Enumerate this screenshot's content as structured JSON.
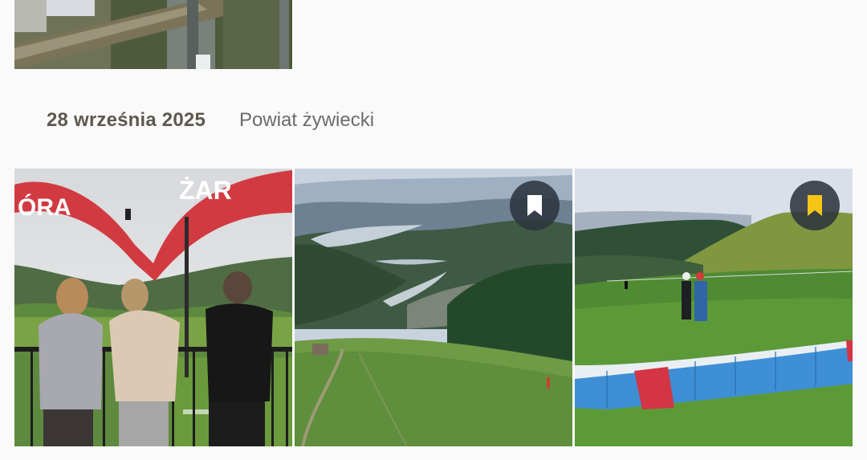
{
  "section": {
    "date": "28 września 2025",
    "location": "Powiat żywiecki"
  },
  "photos": [
    {
      "sign_left": "ÓRA",
      "sign_right": "ŻAR",
      "bookmark": null
    },
    {
      "bookmark": {
        "state": "unselected",
        "icon": "bookmark-icon",
        "color": "#ffffff"
      }
    },
    {
      "bookmark": {
        "state": "selected",
        "icon": "bookmark-icon",
        "color": "#f5c518"
      }
    }
  ]
}
